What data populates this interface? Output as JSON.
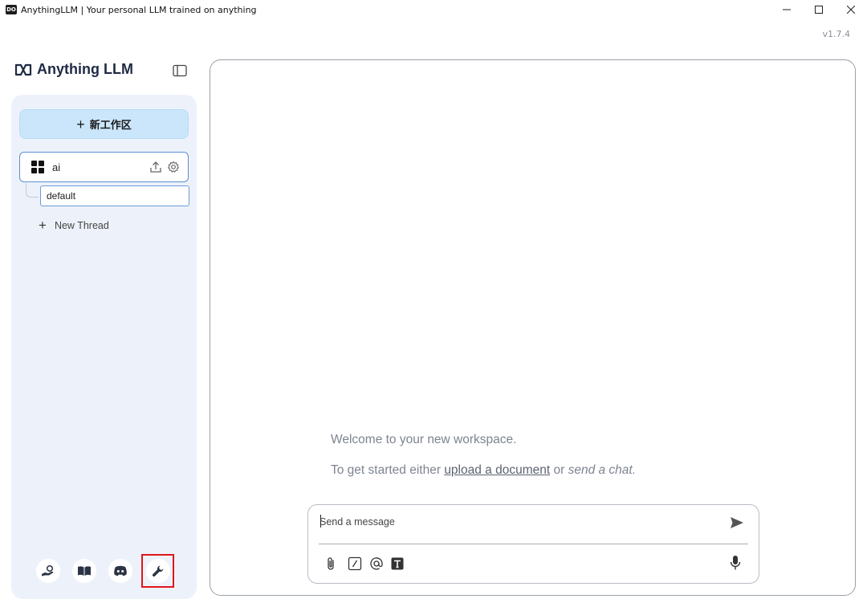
{
  "window": {
    "title": "AnythingLLM | Your personal LLM trained on anything",
    "icon_text": "DO",
    "controls": {
      "minimize": "–",
      "maximize": "☐",
      "close": "✕"
    }
  },
  "version": "v1.7.4",
  "brand": {
    "name": "Anything LLM",
    "logo_icon": "anything-llm-logo-icon"
  },
  "sidebar": {
    "new_workspace_label": "新工作区",
    "new_workspace_icon": "+",
    "workspaces": [
      {
        "name": "ai",
        "icon": "workspace-grid-icon",
        "actions": [
          "upload-icon",
          "gear-icon"
        ]
      }
    ],
    "threads": [
      {
        "name": "default"
      }
    ],
    "new_thread_label": "New Thread",
    "new_thread_icon": "+",
    "footer_icons": [
      "community-hub-icon",
      "docs-book-icon",
      "discord-icon",
      "settings-wrench-icon"
    ]
  },
  "main": {
    "welcome_text": "Welcome to your new workspace.",
    "started_prefix": "To get started either ",
    "upload_link": "upload a document",
    "or_text": " or ",
    "send_chat": "send a chat",
    "period": ".",
    "composer": {
      "placeholder": "Send a message",
      "tools": [
        "paperclip-icon",
        "slash-command-icon",
        "at-agent-icon",
        "text-size-icon"
      ],
      "send_icon": "send-arrow-icon",
      "mic_icon": "microphone-icon"
    }
  },
  "colors": {
    "new_workspace_bg": "#cbe6fb",
    "sidebar_bg": "#edf2fa",
    "highlight_box": "#e0141a",
    "selected_border": "#5a8fd8"
  }
}
